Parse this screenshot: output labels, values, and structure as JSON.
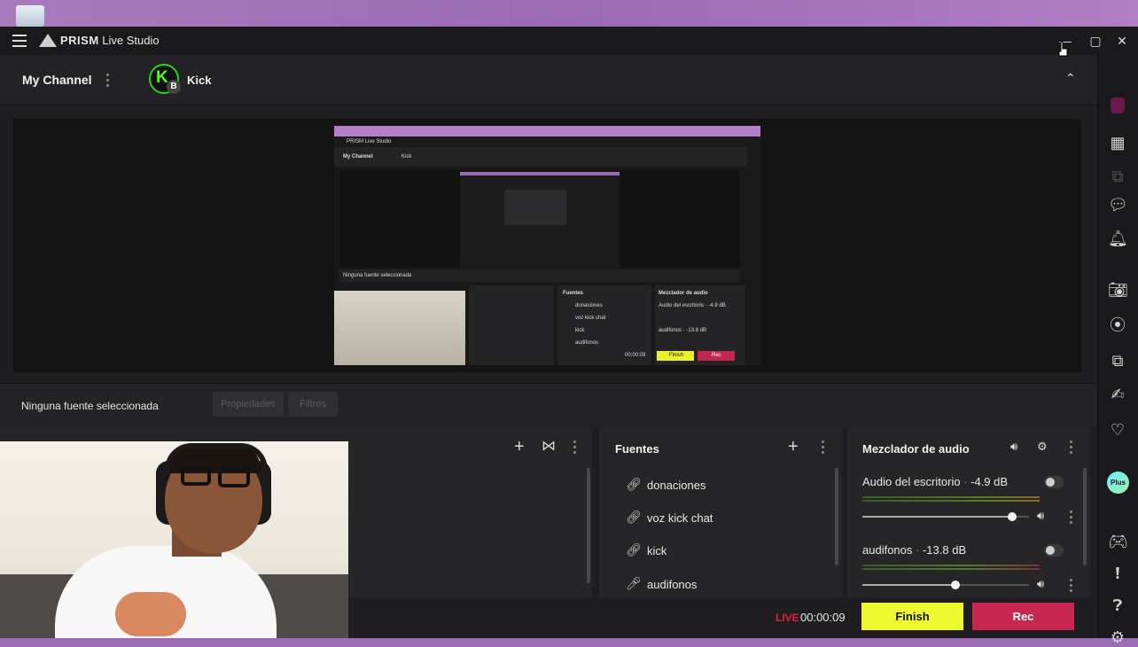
{
  "window": {
    "app_name": "PRISM",
    "app_subtitle": "Live Studio"
  },
  "channel_bar": {
    "my_channel": "My Channel",
    "platform_initial": "K",
    "platform_badge": "B",
    "platform_name": "Kick"
  },
  "source_bar": {
    "status": "Ninguna fuente seleccionada",
    "properties_label": "Propiedades",
    "filters_label": "Filtros"
  },
  "sources_panel": {
    "title": "Fuentes",
    "items": [
      {
        "label": "donaciones",
        "icon": "link-icon"
      },
      {
        "label": "voz kick chat",
        "icon": "link-icon"
      },
      {
        "label": "kick",
        "icon": "link-icon"
      },
      {
        "label": "audifonos",
        "icon": "microphone-icon"
      }
    ]
  },
  "mixer_panel": {
    "title": "Mezclador de audio",
    "channels": [
      {
        "name": "Audio del escritorio",
        "db": "-4.9 dB",
        "volume": 0.9
      },
      {
        "name": "audifonos",
        "db": "-13.8 dB",
        "volume": 0.56
      }
    ]
  },
  "bottom_bar": {
    "live_label": "LIVE",
    "elapsed": "00:00:09",
    "finish_label": "Finish",
    "rec_label": "Rec"
  },
  "preview_thumbnail": {
    "app_name": "PRISM Live Studio",
    "my_channel": "My Channel",
    "platform_name": "Kick",
    "status": "Ninguna fuente seleccionada",
    "sources_title": "Fuentes",
    "mixer_title": "Mezclador de audio",
    "sources": [
      "donaciones",
      "voz kick chat",
      "kick",
      "audifonos"
    ],
    "mixer_rows": [
      "Audio del escritorio · -4.9 dB",
      "audifonos · -13.8 dB"
    ],
    "elapsed": "00:00:09",
    "finish_label": "Finish",
    "rec_label": "Rec"
  },
  "sidebar": {
    "plus_badge": "Plus"
  },
  "colors": {
    "accent_finish": "#eefa2e",
    "accent_rec": "#c72751",
    "live_red": "#e01f3d",
    "kick_green": "#53fc18"
  }
}
